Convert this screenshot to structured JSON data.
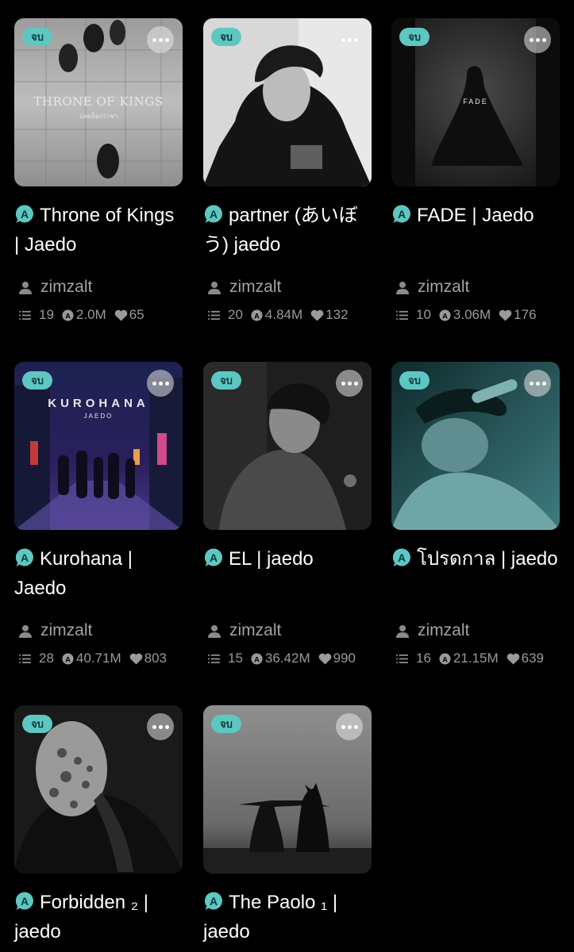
{
  "badge_label": "จบ",
  "accent_color": "#5ec7c2",
  "icons": {
    "chapters": "list-icon",
    "views": "a-circle-icon",
    "likes": "heart-icon",
    "author": "person-icon",
    "more": "more-dots-icon"
  },
  "stories": [
    {
      "title": "Throne of Kings | Jaedo",
      "cover_text": "THRONE OF KINGS",
      "cover_subtext": "ปลดล็อกราชา",
      "author": "zimzalt",
      "chapters": "19",
      "views": "2.0M",
      "likes": "65"
    },
    {
      "title": "partner (あいぼう) jaedo",
      "author": "zimzalt",
      "chapters": "20",
      "views": "4.84M",
      "likes": "132"
    },
    {
      "title": "FADE | Jaedo",
      "cover_text": "FADE",
      "author": "zimzalt",
      "chapters": "10",
      "views": "3.06M",
      "likes": "176"
    },
    {
      "title": "Kurohana | Jaedo",
      "cover_text": "KUROHANA",
      "cover_subtext": "JAEDO",
      "author": "zimzalt",
      "chapters": "28",
      "views": "40.71M",
      "likes": "803"
    },
    {
      "title": "EL | jaedo",
      "author": "zimzalt",
      "chapters": "15",
      "views": "36.42M",
      "likes": "990"
    },
    {
      "title": "โปรดกาล | jaedo",
      "author": "zimzalt",
      "chapters": "16",
      "views": "21.15M",
      "likes": "639"
    },
    {
      "title": "Forbidden ₂ | jaedo"
    },
    {
      "title": "The Paolo ₁ | jaedo"
    }
  ]
}
